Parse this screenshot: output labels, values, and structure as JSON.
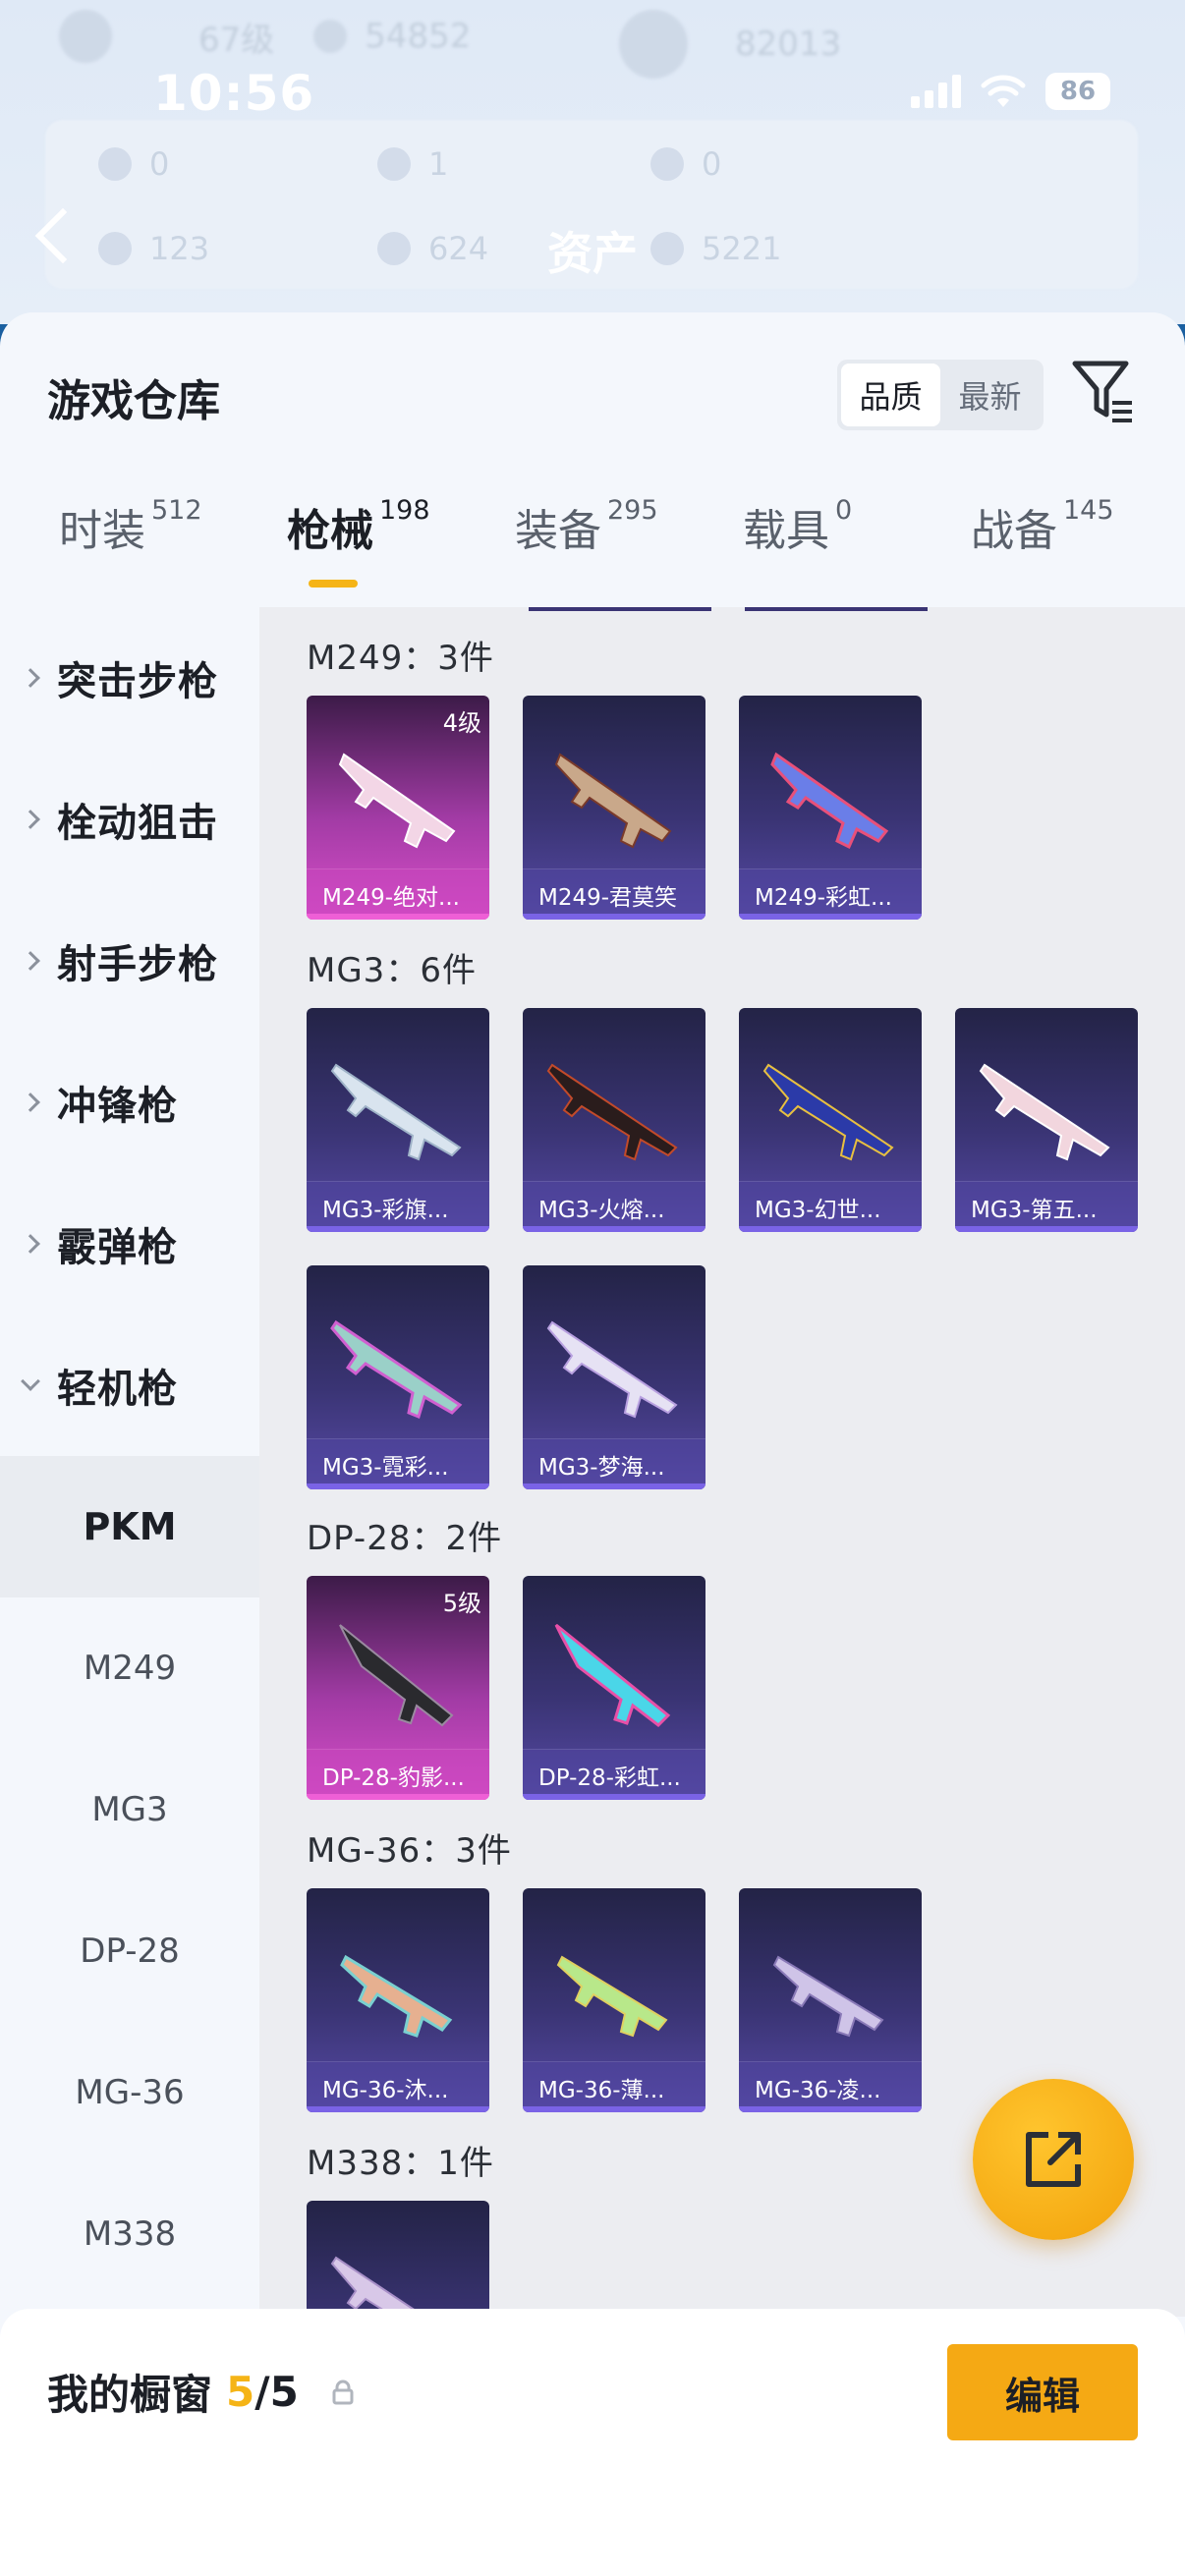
{
  "status_bar": {
    "time": "10:56",
    "battery": "86"
  },
  "background": {
    "level": "67级",
    "coins": "54852",
    "score": "82013",
    "stats": [
      "0",
      "1",
      "0",
      "123",
      "624",
      "5221"
    ]
  },
  "nav": {
    "title": "资产"
  },
  "sheet": {
    "title": "游戏仓库",
    "sort_options": [
      {
        "label": "品质",
        "active": true
      },
      {
        "label": "最新",
        "active": false
      }
    ]
  },
  "tabs": [
    {
      "label": "时装",
      "count": "512"
    },
    {
      "label": "枪械",
      "count": "198",
      "active": true
    },
    {
      "label": "装备",
      "count": "295"
    },
    {
      "label": "载具",
      "count": "0"
    },
    {
      "label": "战备",
      "count": "145"
    }
  ],
  "categories": [
    {
      "label": "突击步枪"
    },
    {
      "label": "栓动狙击"
    },
    {
      "label": "射手步枪"
    },
    {
      "label": "冲锋枪"
    },
    {
      "label": "霰弹枪"
    },
    {
      "label": "轻机枪",
      "expanded": true
    }
  ],
  "subcategories": [
    {
      "label": "PKM",
      "active": true
    },
    {
      "label": "M249"
    },
    {
      "label": "MG3"
    },
    {
      "label": "DP-28"
    },
    {
      "label": "MG-36"
    },
    {
      "label": "M338"
    }
  ],
  "groups": [
    {
      "heading": "M249：3件",
      "items": [
        {
          "name": "M249-绝对...",
          "grade": "4级",
          "highlight": true
        },
        {
          "name": "M249-君莫笑"
        },
        {
          "name": "M249-彩虹..."
        }
      ]
    },
    {
      "heading": "MG3：6件",
      "items": [
        {
          "name": "MG3-彩旗..."
        },
        {
          "name": "MG3-火熔..."
        },
        {
          "name": "MG3-幻世..."
        },
        {
          "name": "MG3-第五..."
        },
        {
          "name": "MG3-霓彩..."
        },
        {
          "name": "MG3-梦海..."
        }
      ]
    },
    {
      "heading": "DP-28：2件",
      "items": [
        {
          "name": "DP-28-豹影...",
          "grade": "5级",
          "highlight": true
        },
        {
          "name": "DP-28-彩虹..."
        }
      ]
    },
    {
      "heading": "MG-36：3件",
      "items": [
        {
          "name": "MG-36-沐..."
        },
        {
          "name": "MG-36-薄..."
        },
        {
          "name": "MG-36-凌..."
        }
      ]
    },
    {
      "heading": "M338：1件",
      "items": [
        {
          "name": ""
        }
      ]
    }
  ],
  "showcase": {
    "label": "我的橱窗",
    "current": "5",
    "separator": "/",
    "total": "5",
    "edit_label": "编辑"
  },
  "icons": {
    "back": "back-arrow-icon",
    "filter": "filter-icon",
    "share": "share-icon",
    "lock": "lock-icon"
  },
  "colors": {
    "accent": "#f5b416",
    "card_normal": "#3a3474",
    "card_highlight": "#d84fc9"
  }
}
